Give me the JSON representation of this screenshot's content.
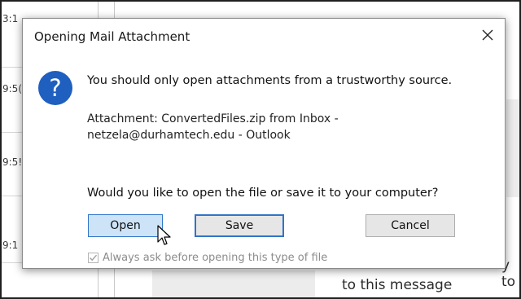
{
  "background": {
    "times": [
      "3:1",
      "9:5(",
      "9:5!",
      "9:1"
    ],
    "message_fragment": "to this message",
    "message_fragment_right": "y to"
  },
  "dialog": {
    "title": "Opening Mail Attachment",
    "close_glyph": "×",
    "icon": "question-icon",
    "icon_glyph": "?",
    "message": "You should only open attachments from a trustworthy source.",
    "attachment_line1": "Attachment: ConvertedFiles.zip from Inbox -",
    "attachment_line2": "netzela@durhamtech.edu - Outlook",
    "question": "Would you like to open the file or save it to your computer?",
    "buttons": {
      "open": "Open",
      "save": "Save",
      "cancel": "Cancel"
    },
    "checkbox": {
      "label": "Always ask before opening this type of file",
      "checked": true,
      "enabled": false
    }
  },
  "colors": {
    "accent": "#2f74c8",
    "icon_blue": "#1e5fbf",
    "open_button_bg": "#cde3f7"
  }
}
